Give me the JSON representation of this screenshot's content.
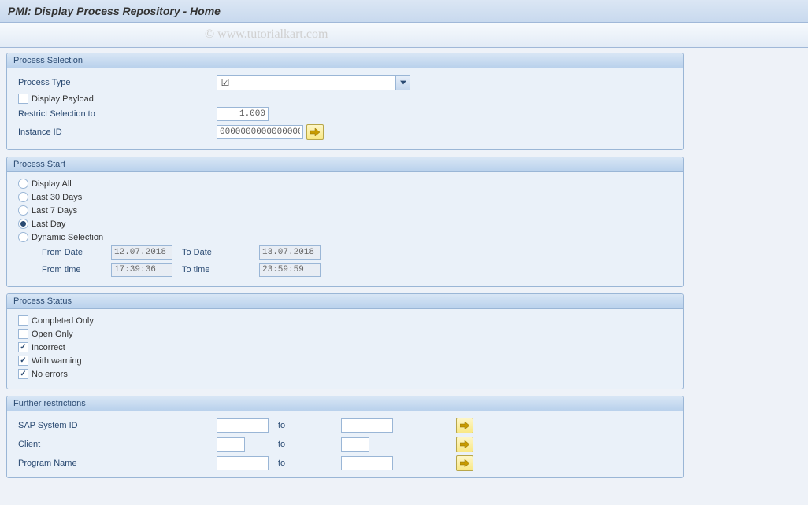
{
  "title": "PMI: Display Process Repository - Home",
  "watermark": "© www.tutorialkart.com",
  "groups": {
    "processSelection": {
      "header": "Process Selection",
      "processTypeLabel": "Process Type",
      "displayPayloadLabel": "Display Payload",
      "restrictLabel": "Restrict Selection to",
      "restrictValue": "1.000",
      "instanceIdLabel": "Instance ID",
      "instanceIdValue": "00000000000000000…"
    },
    "processStart": {
      "header": "Process Start",
      "options": {
        "displayAll": "Display All",
        "last30": "Last 30 Days",
        "last7": "Last 7 Days",
        "lastDay": "Last Day",
        "dynamic": "Dynamic Selection"
      },
      "fromDateLabel": "From Date",
      "fromDateValue": "12.07.2018",
      "toDateLabel": "To Date",
      "toDateValue": "13.07.2018",
      "fromTimeLabel": "From time",
      "fromTimeValue": "17:39:36",
      "toTimeLabel": "To time",
      "toTimeValue": "23:59:59"
    },
    "processStatus": {
      "header": "Process Status",
      "completedLabel": "Completed Only",
      "openLabel": "Open Only",
      "incorrectLabel": "Incorrect",
      "warningLabel": "With warning",
      "noErrorsLabel": "No errors"
    },
    "further": {
      "header": "Further restrictions",
      "sapSystemLabel": "SAP System ID",
      "clientLabel": "Client",
      "programLabel": "Program Name",
      "toLabel": "to"
    }
  }
}
